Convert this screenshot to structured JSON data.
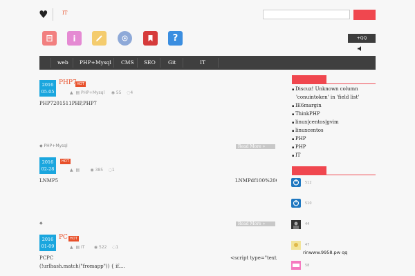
{
  "header": {
    "site_name": "IT",
    "search_placeholder": "",
    "qq_label": "+QQ"
  },
  "nav": [
    "web",
    "PHP+Mysql",
    "CMS",
    "SEO",
    "Git",
    "IT"
  ],
  "icons": [
    "note-icon",
    "info-icon",
    "edit-icon",
    "badge-icon",
    "bookmark-icon",
    "help-icon"
  ],
  "colors": {
    "accent": "#f0474f",
    "date_blue": "#1aa6de",
    "title_orange": "#e8502a",
    "nav_bg": "#3f3f3f"
  },
  "posts": [
    {
      "year": "2016",
      "date": "05-05",
      "title": "PHP7",
      "hot": "HOT",
      "category": "PHP+Mysql",
      "views": "55",
      "comments": "4",
      "excerpt_left": "PHP7201511PHP,PHP7",
      "excerpt_right": "",
      "tag": "PHP+Mysql",
      "readmore": "Read More »"
    },
    {
      "year": "2016",
      "date": "02-28",
      "title": "",
      "hot": "HOT",
      "category": "",
      "views": "385",
      "comments": "1",
      "excerpt_left": "LNMP5",
      "excerpt_right": "LNMPdf100%20GN",
      "tag": "",
      "readmore": "Read More »"
    },
    {
      "year": "2016",
      "date": "01-09",
      "title": "PC",
      "hot": "HOT",
      "category": "IT",
      "views": "522",
      "comments": "1",
      "excerpt_left": "PCPC",
      "excerpt_right": "<script type=\"text/ja",
      "excerpt_line2": "(!urlhash.match(\"fromapp\")) { if....",
      "tag": "",
      "readmore": ""
    }
  ],
  "sidebar": {
    "recent": [
      "Discuz! Unknown column",
      "'conuintoken' in 'field list'",
      "IE6margin",
      "ThinkPHP",
      "linux|centos|gvim",
      "linuxcentos",
      "PHP",
      "PHP",
      "IT"
    ],
    "comments": [
      {
        "num": "512",
        "text": ""
      },
      {
        "num": "510",
        "text": ""
      },
      {
        "num": "44",
        "text": ""
      },
      {
        "num": "47",
        "text": "rinwww.9958.pw qq"
      },
      {
        "num": "58",
        "text": ""
      }
    ]
  }
}
